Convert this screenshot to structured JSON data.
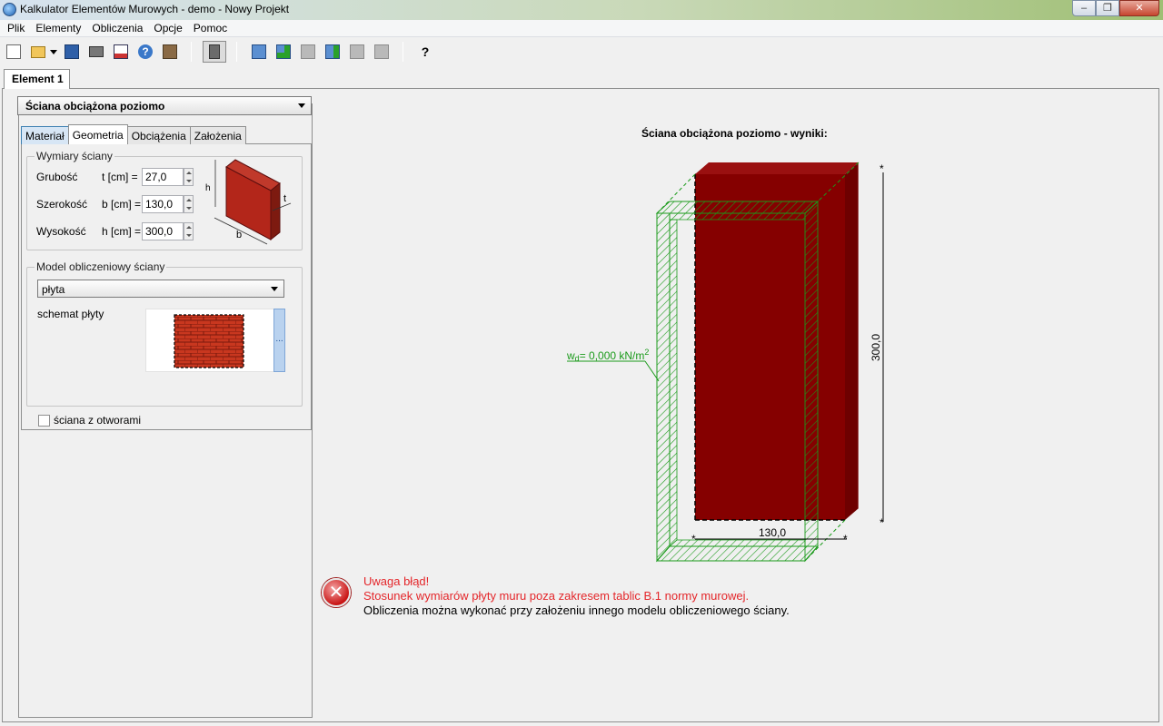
{
  "window": {
    "title": "Kalkulator Elementów Murowych - demo - Nowy Projekt",
    "minimize": "–",
    "maximize": "❐",
    "close": "✕"
  },
  "menu": [
    "Plik",
    "Elementy",
    "Obliczenia",
    "Opcje",
    "Pomoc"
  ],
  "toolbar": {
    "whats_this": "?"
  },
  "document_tab": "Element 1",
  "element_type": "Ściana obciążona poziomo",
  "tabs": [
    "Materiał",
    "Geometria",
    "Obciążenia",
    "Założenia"
  ],
  "dimensions": {
    "legend": "Wymiary ściany",
    "rows": [
      {
        "label": "Grubość",
        "symbol": "t [cm] =",
        "value": "27,0"
      },
      {
        "label": "Szerokość",
        "symbol": "b [cm] =",
        "value": "130,0"
      },
      {
        "label": "Wysokość",
        "symbol": "h [cm] =",
        "value": "300,0"
      }
    ],
    "sketch_labels": {
      "h": "h",
      "t": "t",
      "b": "b"
    }
  },
  "model": {
    "legend": "Model obliczeniowy ściany",
    "selected": "płyta",
    "schema_label": "schemat płyty",
    "schema_button": "..."
  },
  "openings_checkbox": "ściana z otworami",
  "results": {
    "title": "Ściana obciążona poziomo - wyniki:",
    "height_label": "300,0",
    "width_label": "130,0",
    "load_label": "w",
    "load_sub": "d",
    "load_value": "= 0,000 kN/m",
    "load_sup": "2"
  },
  "error": {
    "icon": "✕",
    "line1": "Uwaga błąd!",
    "line2": "Stosunek wymiarów płyty muru poza zakresem tablic B.1 normy murowej.",
    "line3": "Obliczenia można wykonać przy założeniu innego modelu obliczeniowego ściany."
  },
  "colors": {
    "brick": "#850000",
    "hatch": "#1a9a1a",
    "error": "#e4262a"
  }
}
